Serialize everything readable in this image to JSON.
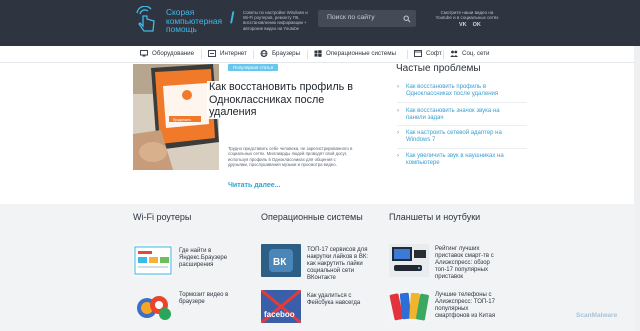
{
  "header": {
    "logo_text": "Скорая компьютерная помощь",
    "description": "Советы по настройке Windows и Wi-Fi роутеров, ремонту ПК, восстановлению информации + авторские видео на Youtube",
    "search_placeholder": "Поиск по сайту",
    "social_text": "Смотрите наши видео на Youtube и в социальных сетях",
    "social": [
      "VK",
      "OK"
    ]
  },
  "nav": {
    "items": [
      {
        "label": "Оборудование",
        "icon": "hardware-icon"
      },
      {
        "label": "Интернет",
        "icon": "internet-icon"
      },
      {
        "label": "Браузеры",
        "icon": "globe-icon"
      },
      {
        "label": "Операционные системы",
        "icon": "windows-icon"
      },
      {
        "label": "Софт",
        "icon": "software-icon"
      },
      {
        "label": "Соц. сети",
        "icon": "people-icon"
      }
    ]
  },
  "featured": {
    "tag": "Популярная статья",
    "title": "Как восстановить профиль в Одноклассниках после удаления",
    "text": "Трудно представить себе человека, не зарегистрированного в социальных сетях. Миллиарды людей проводят свой досуг, используя профиль в Одноклассниках для общения с друзьями, прослушивания музыки и просмотра видео.",
    "read_more": "Читать далее...",
    "image_word": "Продолжить"
  },
  "faq": {
    "title": "Частые проблемы",
    "items": [
      "Как восстановить профиль в Одноклассниках после удаления",
      "Как восстановить значок звука на панели задач",
      "Как настроить сетевой адаптер на Windows 7",
      "Как увеличить звук в наушниках на компьютере"
    ]
  },
  "columns": [
    {
      "title": "Wi-Fi роутеры",
      "cards": [
        {
          "text": "Где найти в Яндекс.Браузере расширения",
          "icon": "browser-extensions-icon"
        },
        {
          "text": "Тормозит видео в браузере",
          "icon": "browser-logos-icon"
        }
      ]
    },
    {
      "title": "Операционные системы",
      "cards": [
        {
          "text": "ТОП-17 сервисов для накрутки лайков в ВК: как накрутить лайки социальной сети ВКонтакте",
          "icon": "vk-logo-icon",
          "img_label": "ВК"
        },
        {
          "text": "Как удалиться с Фейсбука навсегда",
          "icon": "facebook-icon",
          "img_label": "faceboo"
        }
      ]
    },
    {
      "title": "Планшеты и ноутбуки",
      "cards": [
        {
          "text": "Рейтинг лучших приставок смарт-тв с Алиэкспресс: обзор топ-17 популярных приставок",
          "icon": "tv-box-icon"
        },
        {
          "text": "Лучшие телефоны с Алиэкспресс: ТОП-17 популярных смартфонов из Китая",
          "icon": "smartphones-icon"
        }
      ]
    }
  ],
  "watermark": "ScanMalware",
  "colors": {
    "header_bg": "#2f3540",
    "accent": "#3fb8e8",
    "link": "#3a9fd0",
    "tag": "#69c6ec",
    "lower_bg": "#f1f3f5"
  }
}
